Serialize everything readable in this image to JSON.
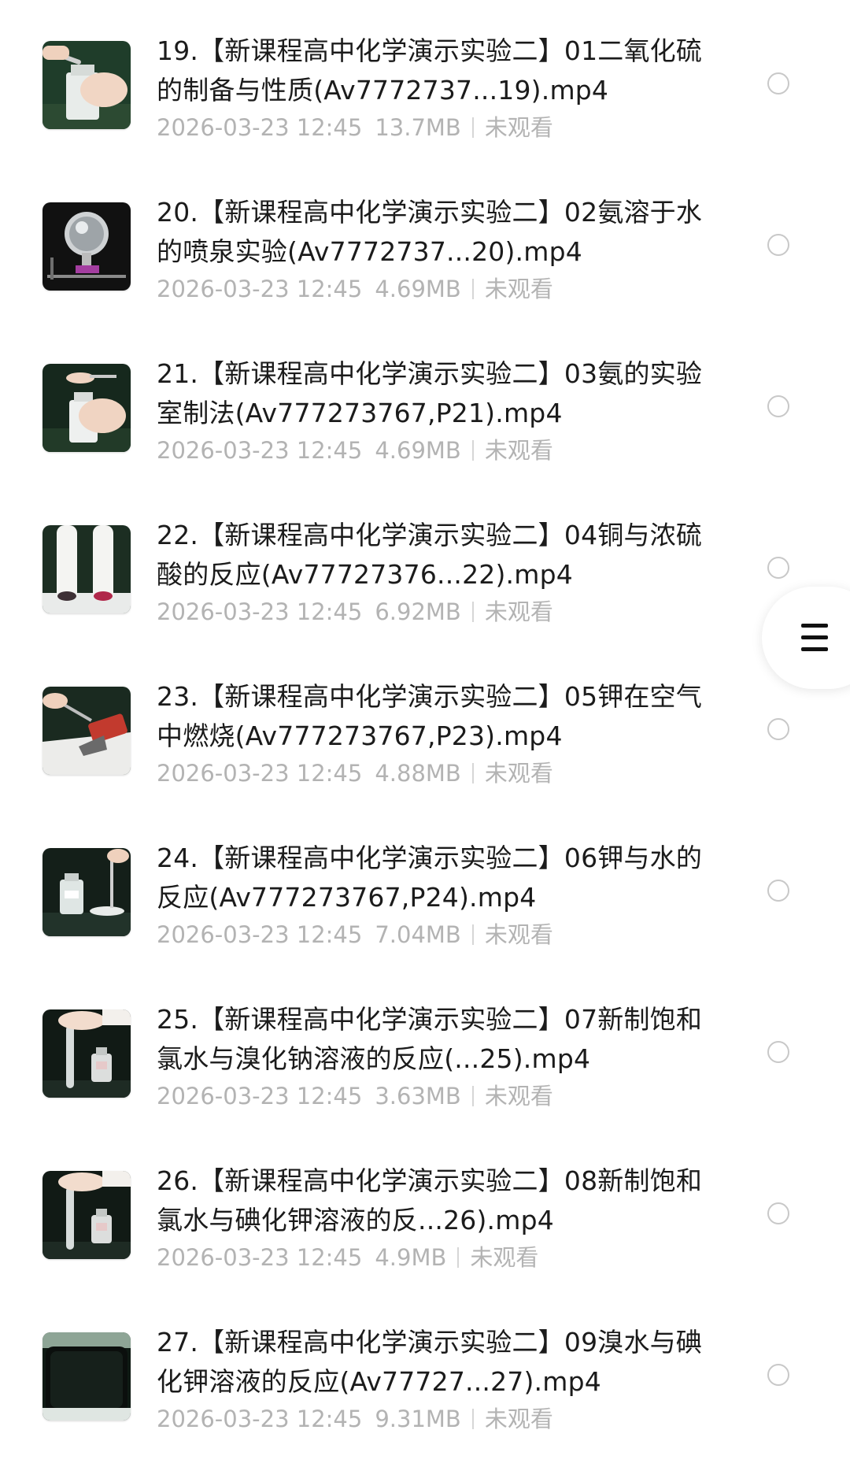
{
  "items": [
    {
      "title": "19.【新课程高中化学演示实验二】01二氧化硫的制备与性质(Av7772737...19).mp4",
      "date": "2026-03-23 12:45",
      "size": "13.7MB",
      "status": "未观看",
      "thumb_icon": "hand-bottle-thumbnail"
    },
    {
      "title": "20.【新课程高中化学演示实验二】02氨溶于水的喷泉实验(Av7772737...20).mp4",
      "date": "2026-03-23 12:45",
      "size": "4.69MB",
      "status": "未观看",
      "thumb_icon": "flask-thumbnail"
    },
    {
      "title": "21.【新课程高中化学演示实验二】03氨的实验室制法(Av777273767,P21).mp4",
      "date": "2026-03-23 12:45",
      "size": "4.69MB",
      "status": "未观看",
      "thumb_icon": "hand-bottle-thumbnail"
    },
    {
      "title": "22.【新课程高中化学演示实验二】04铜与浓硫酸的反应(Av77727376...22).mp4",
      "date": "2026-03-23 12:45",
      "size": "6.92MB",
      "status": "未观看",
      "thumb_icon": "test-tubes-thumbnail"
    },
    {
      "title": "23.【新课程高中化学演示实验二】05钾在空气中燃烧(Av777273767,P23).mp4",
      "date": "2026-03-23 12:45",
      "size": "4.88MB",
      "status": "未观看",
      "thumb_icon": "tweezers-thumbnail"
    },
    {
      "title": "24.【新课程高中化学演示实验二】06钾与水的反应(Av777273767,P24).mp4",
      "date": "2026-03-23 12:45",
      "size": "7.04MB",
      "status": "未观看",
      "thumb_icon": "bottle-dish-thumbnail"
    },
    {
      "title": "25.【新课程高中化学演示实验二】07新制饱和氯水与溴化钠溶液的反应(...25).mp4",
      "date": "2026-03-23 12:45",
      "size": "3.63MB",
      "status": "未观看",
      "thumb_icon": "test-tube-bottle-thumbnail"
    },
    {
      "title": "26.【新课程高中化学演示实验二】08新制饱和氯水与碘化钾溶液的反...26).mp4",
      "date": "2026-03-23 12:45",
      "size": "4.9MB",
      "status": "未观看",
      "thumb_icon": "test-tube-bottle-thumbnail"
    },
    {
      "title": "27.【新课程高中化学演示实验二】09溴水与碘化钾溶液的反应(Av77727...27).mp4",
      "date": "2026-03-23 12:45",
      "size": "9.31MB",
      "status": "未观看",
      "thumb_icon": "dark-solution-thumbnail"
    }
  ],
  "float_menu": {
    "icon": "hamburger-menu-icon"
  },
  "colors": {
    "title": "#1b1b1b",
    "meta": "#b3b3b3",
    "radio_border": "#c8c8c8"
  }
}
